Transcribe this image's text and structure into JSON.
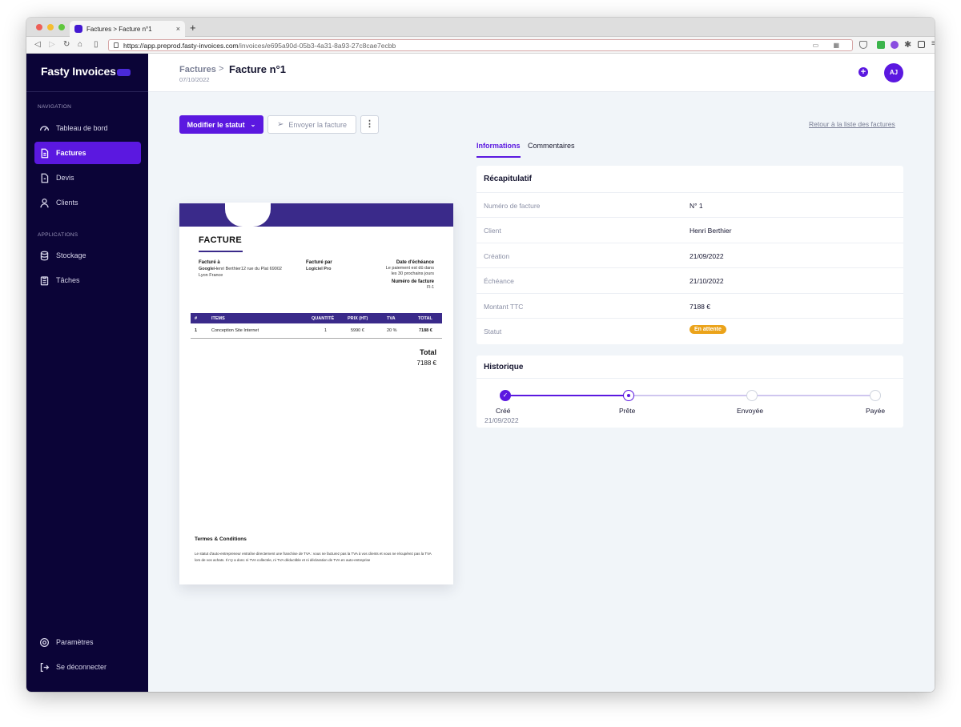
{
  "browser": {
    "tab_title": "Factures > Facture n°1",
    "tab_close": "×",
    "new_tab": "+",
    "url_host": "https://app.preprod.fasty-invoices.com",
    "url_path": "/invoices/e695a90d-05b3-4a31-8a93-27c8cae7ecbb"
  },
  "sidebar": {
    "logo": "Fasty Invoices",
    "navigation_label": "NAVIGATION",
    "applications_label": "APPLICATIONS",
    "items": [
      {
        "label": "Tableau de bord",
        "icon": "dashboard-icon"
      },
      {
        "label": "Factures",
        "icon": "invoice-icon",
        "active": true
      },
      {
        "label": "Devis",
        "icon": "quote-icon"
      },
      {
        "label": "Clients",
        "icon": "user-icon"
      }
    ],
    "apps": [
      {
        "label": "Stockage",
        "icon": "database-icon"
      },
      {
        "label": "Tâches",
        "icon": "clipboard-icon"
      }
    ],
    "bottom": [
      {
        "label": "Paramètres",
        "icon": "gear-icon"
      },
      {
        "label": "Se déconnecter",
        "icon": "logout-icon"
      }
    ]
  },
  "header": {
    "breadcrumb_parent": "Factures",
    "breadcrumb_sep": ">",
    "title": "Facture n°1",
    "date": "07/10/2022",
    "avatar": "AJ"
  },
  "actions": {
    "status_button": "Modifier le statut",
    "send_button": "Envoyer la facture",
    "more_button": "⋮",
    "back_link": "Retour à la liste des factures"
  },
  "tabs": [
    "Informations",
    "Commentaires"
  ],
  "invoice": {
    "title": "FACTURE",
    "billed_to_label": "Facturé à",
    "billed_to_line1_bold": "Google",
    "billed_to_line1": "Henri Berthier12 rue du Plat 69002",
    "billed_to_line2": "Lyon France",
    "billed_by_label": "Facturé par",
    "billed_by": "Logiciel Pro",
    "due_label": "Date d'échéance",
    "due_line1": "Le paiement est dû dans",
    "due_line2": "les 30 prochains jours",
    "number_label": "Numéro de facture",
    "number": "FI-1",
    "columns": [
      "#",
      "ITEMS",
      "QUANTITÉ",
      "PRIX (HT)",
      "TVA",
      "TOTAL"
    ],
    "rows": [
      [
        "1",
        "Conception Site Internet",
        "1",
        "5990 €",
        "20 %",
        "7188 €"
      ]
    ],
    "total_label": "Total",
    "total_value": "7188 €",
    "terms_title": "Termes & Conditions",
    "terms_text": "Le statut d'auto-entrepreneur entraîne directement une franchise de TVA : vous ne facturez pas la TVA à vos clients et vous ne récupérez pas la TVA lors de vos achats. Il n'y a donc ni TVA collectée, ni TVA déductible et ni déclaration de TVA en auto-entreprise"
  },
  "summary": {
    "title": "Récapitulatif",
    "rows": [
      {
        "label": "Numéro de facture",
        "value": "N° 1"
      },
      {
        "label": "Client",
        "value": "Henri Berthier"
      },
      {
        "label": "Création",
        "value": "21/09/2022"
      },
      {
        "label": "Échéance",
        "value": "21/10/2022"
      },
      {
        "label": "Montant TTC",
        "value": "7188 €"
      }
    ],
    "status_label": "Statut",
    "status_value": "En attente"
  },
  "history": {
    "title": "Historique",
    "steps": [
      {
        "label": "Créé",
        "date": "21/09/2022",
        "state": "done"
      },
      {
        "label": "Prête",
        "date": "",
        "state": "current"
      },
      {
        "label": "Envoyée",
        "date": "",
        "state": "todo"
      },
      {
        "label": "Payée",
        "date": "",
        "state": "todo"
      }
    ]
  },
  "colors": {
    "sidebar_bg": "#0b0437",
    "accent": "#5b18e0",
    "invoice_header": "#3a2a8a",
    "status_badge": "#eba31a",
    "page_bg": "#f1f5f9"
  }
}
